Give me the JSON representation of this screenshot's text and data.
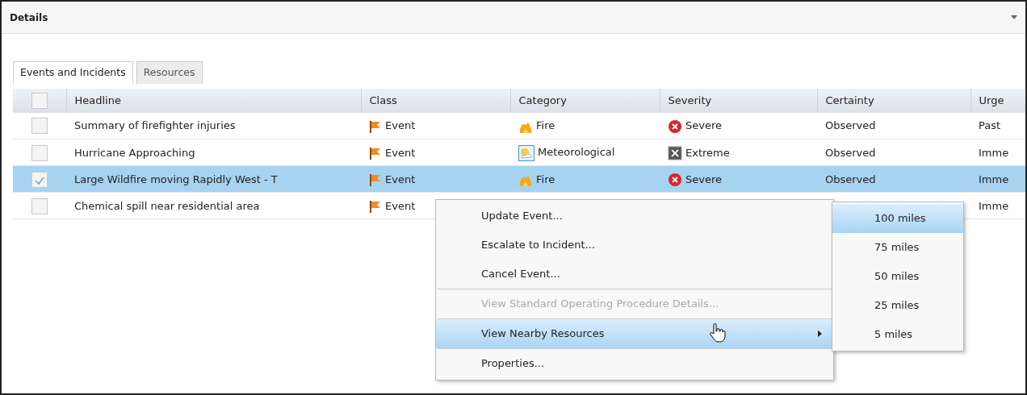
{
  "panel": {
    "title": "Details"
  },
  "tabs": [
    {
      "label": "Events and Incidents",
      "selected": true
    },
    {
      "label": "Resources",
      "selected": false
    }
  ],
  "table": {
    "header_checked": false,
    "columns": [
      "Headline",
      "Class",
      "Category",
      "Severity",
      "Certainty",
      "Urge"
    ],
    "rows": [
      {
        "checked": false,
        "selected": false,
        "headline": "Summary of firefighter injuries",
        "class": "Event",
        "category": {
          "text": "Fire",
          "kind": "fire"
        },
        "severity": {
          "text": "Severe",
          "kind": "severe"
        },
        "certainty": "Observed",
        "urgency": "Past"
      },
      {
        "checked": false,
        "selected": false,
        "headline": "Hurricane Approaching",
        "class": "Event",
        "category": {
          "text": "Meteorological",
          "kind": "meteorological"
        },
        "severity": {
          "text": "Extreme",
          "kind": "extreme"
        },
        "certainty": "Observed",
        "urgency": "Imme"
      },
      {
        "checked": true,
        "selected": true,
        "headline": "Large Wildfire moving Rapidly West - T",
        "class": "Event",
        "category": {
          "text": "Fire",
          "kind": "fire"
        },
        "severity": {
          "text": "Severe",
          "kind": "severe"
        },
        "certainty": "Observed",
        "urgency": "Imme"
      },
      {
        "checked": false,
        "selected": false,
        "headline": "Chemical spill near residential area",
        "class": "Event",
        "urgency": "Imme"
      }
    ]
  },
  "context_menu": {
    "items": [
      {
        "label": "Update Event...",
        "disabled": false,
        "highlighted": false,
        "submenu": false
      },
      {
        "label": "Escalate to Incident...",
        "disabled": false,
        "highlighted": false,
        "submenu": false
      },
      {
        "label": "Cancel Event...",
        "disabled": false,
        "highlighted": false,
        "submenu": false
      },
      {
        "label": "View Standard Operating Procedure Details...",
        "disabled": true,
        "highlighted": false,
        "submenu": false
      },
      {
        "label": "View Nearby Resources",
        "disabled": false,
        "highlighted": true,
        "submenu": true
      },
      {
        "label": "Properties...",
        "disabled": false,
        "highlighted": false,
        "submenu": false
      }
    ],
    "submenu": [
      {
        "label": "100 miles",
        "selected": true
      },
      {
        "label": "75 miles",
        "selected": false
      },
      {
        "label": "50 miles",
        "selected": false
      },
      {
        "label": "25 miles",
        "selected": false
      },
      {
        "label": "5 miles",
        "selected": false
      }
    ]
  }
}
